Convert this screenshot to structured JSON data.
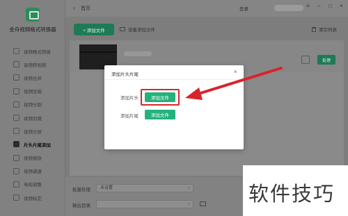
{
  "app": {
    "name": "金舟视频格式转换器",
    "home_label": "首页",
    "login_label": "登录"
  },
  "sidebar": {
    "items": [
      {
        "label": "视频格式转换",
        "icon": "video-convert-icon"
      },
      {
        "label": "音频转视频",
        "icon": "audio-icon"
      },
      {
        "label": "视频合并",
        "icon": "merge-icon"
      },
      {
        "label": "视频压缩",
        "icon": "compress-icon"
      },
      {
        "label": "视频分割",
        "icon": "cut-icon"
      },
      {
        "label": "视频剪辑",
        "icon": "edit-icon"
      },
      {
        "label": "视频分屏",
        "icon": "split-screen-icon"
      },
      {
        "label": "片头片尾添加",
        "icon": "intro-outro-icon",
        "active": true
      },
      {
        "label": "视频倒放",
        "icon": "reverse-icon"
      },
      {
        "label": "视频调速",
        "icon": "speed-icon"
      },
      {
        "label": "电视调整",
        "icon": "tv-icon"
      },
      {
        "label": "视频标定",
        "icon": "mark-icon"
      }
    ]
  },
  "toolbar": {
    "add_file_label": "+ 添加文件",
    "device_add_label": "设备添加文件",
    "clear_list_label": "清空列表"
  },
  "file_row": {
    "action_label": "处理"
  },
  "bottom": {
    "batch_label": "批量处理",
    "batch_value": "未设置",
    "output_label": "输出目录"
  },
  "modal": {
    "title": "添加片头片尾",
    "close_glyph": "×",
    "intro_label": "添加片头",
    "intro_button": "添加文件",
    "outro_label": "添加片尾",
    "outro_button": "添加文件"
  },
  "watermark": {
    "text": "软件技巧"
  },
  "colors": {
    "accent_green": "#23b27e",
    "highlight_red": "#d8242c"
  }
}
